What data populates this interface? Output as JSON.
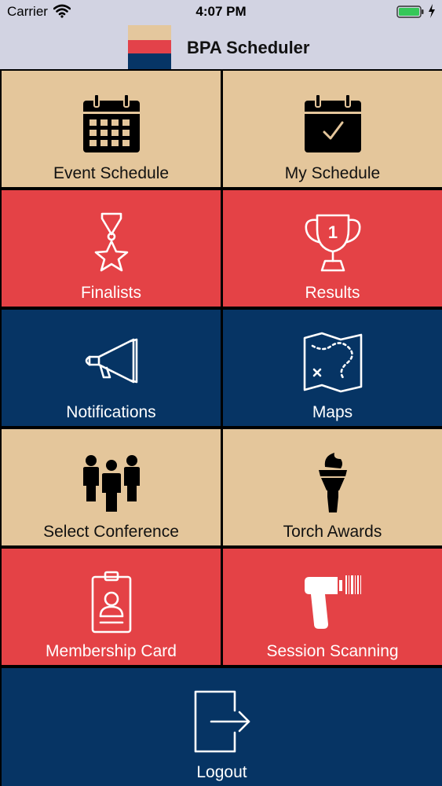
{
  "status_bar": {
    "carrier": "Carrier",
    "time": "4:07 PM"
  },
  "nav_bar": {
    "title": "BPA Scheduler",
    "logo_colors": [
      "#e4c79d",
      "#e3424a",
      "#063566"
    ]
  },
  "colors": {
    "tan": "#e4c69b",
    "red": "#e44246",
    "navy": "#063464"
  },
  "menu": {
    "event_schedule": {
      "label": "Event Schedule",
      "icon": "calendar-grid-icon"
    },
    "my_schedule": {
      "label": "My Schedule",
      "icon": "calendar-check-icon"
    },
    "finalists": {
      "label": "Finalists",
      "icon": "medal-star-icon"
    },
    "results": {
      "label": "Results",
      "icon": "trophy-icon"
    },
    "notifications": {
      "label": "Notifications",
      "icon": "megaphone-icon"
    },
    "maps": {
      "label": "Maps",
      "icon": "map-icon"
    },
    "select_conference": {
      "label": "Select Conference",
      "icon": "people-group-icon"
    },
    "torch_awards": {
      "label": "Torch Awards",
      "icon": "torch-icon"
    },
    "membership_card": {
      "label": "Membership Card",
      "icon": "id-badge-icon"
    },
    "session_scanning": {
      "label": "Session Scanning",
      "icon": "barcode-scanner-icon"
    },
    "logout": {
      "label": "Logout",
      "icon": "logout-icon"
    }
  },
  "icon_text": {
    "trophy_number": "1"
  }
}
